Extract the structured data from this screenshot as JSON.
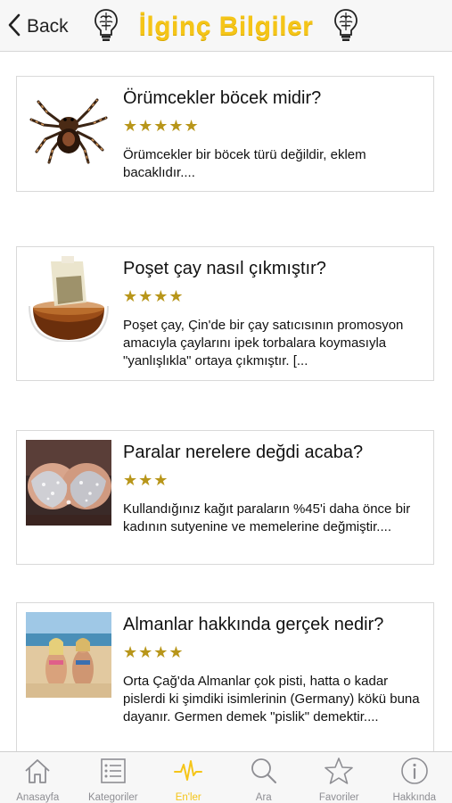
{
  "header": {
    "back_label": "Back",
    "title": "İlginç Bilgiler",
    "accent": "#f5c518",
    "icons": [
      "brain-bulb-icon",
      "brain-bulb-icon"
    ]
  },
  "articles": [
    {
      "title": "Örümcekler böcek midir?",
      "stars": "★★★★★",
      "rating": 5,
      "excerpt": "Örümcekler bir böcek türü değildir, eklem bacaklıdır....",
      "image": "spider-image"
    },
    {
      "title": "Poşet çay nasıl çıkmıştır?",
      "stars": "★★★★",
      "rating": 4,
      "excerpt": "Poşet çay, Çin'de bir çay satıcısının promosyon amacıyla çaylarını ipek torbalara koymasıyla \"yanlışlıkla\" ortaya çıkmıştır.      [...",
      "image": "tea-bag-image"
    },
    {
      "title": "Paralar nerelere değdi acaba?",
      "stars": "★★★",
      "rating": 3,
      "excerpt": "Kullandığınız kağıt paraların %45'i daha önce bir kadının sutyenine ve memelerine değmiştir....",
      "image": "jeweled-bra-image"
    },
    {
      "title": "Almanlar hakkında gerçek nedir?",
      "stars": "★★★★",
      "rating": 4,
      "excerpt": "Orta Çağ'da Almanlar çok pisti, hatta o kadar pislerdi ki şimdiki isimlerinin (Germany) kökü buna dayanır. Germen demek \"pislik\" demektir....",
      "image": "beach-image"
    }
  ],
  "tabbar": {
    "active": "En'ler",
    "active_color": "#f5c518",
    "inactive_color": "#8e8e93",
    "tabs": [
      {
        "label": "Anasayfa",
        "icon": "home-icon"
      },
      {
        "label": "Kategoriler",
        "icon": "list-icon"
      },
      {
        "label": "En'ler",
        "icon": "heartbeat-icon"
      },
      {
        "label": "Ara",
        "icon": "search-icon"
      },
      {
        "label": "Favoriler",
        "icon": "star-icon"
      },
      {
        "label": "Hakkında",
        "icon": "info-icon"
      }
    ]
  }
}
